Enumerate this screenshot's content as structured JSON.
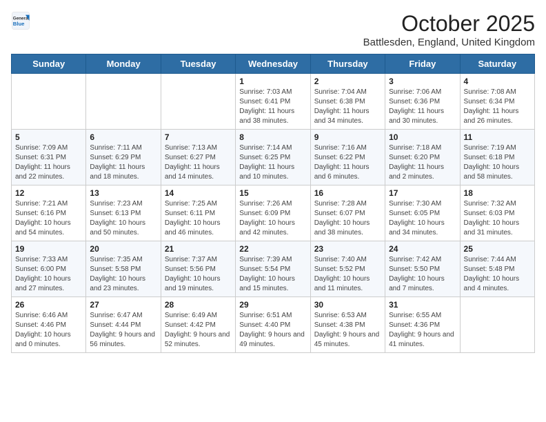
{
  "header": {
    "logo": {
      "general": "General",
      "blue": "Blue"
    },
    "title": "October 2025",
    "location": "Battlesden, England, United Kingdom"
  },
  "weekdays": [
    "Sunday",
    "Monday",
    "Tuesday",
    "Wednesday",
    "Thursday",
    "Friday",
    "Saturday"
  ],
  "weeks": [
    [
      {
        "day": "",
        "info": ""
      },
      {
        "day": "",
        "info": ""
      },
      {
        "day": "",
        "info": ""
      },
      {
        "day": "1",
        "info": "Sunrise: 7:03 AM\nSunset: 6:41 PM\nDaylight: 11 hours and 38 minutes."
      },
      {
        "day": "2",
        "info": "Sunrise: 7:04 AM\nSunset: 6:38 PM\nDaylight: 11 hours and 34 minutes."
      },
      {
        "day": "3",
        "info": "Sunrise: 7:06 AM\nSunset: 6:36 PM\nDaylight: 11 hours and 30 minutes."
      },
      {
        "day": "4",
        "info": "Sunrise: 7:08 AM\nSunset: 6:34 PM\nDaylight: 11 hours and 26 minutes."
      }
    ],
    [
      {
        "day": "5",
        "info": "Sunrise: 7:09 AM\nSunset: 6:31 PM\nDaylight: 11 hours and 22 minutes."
      },
      {
        "day": "6",
        "info": "Sunrise: 7:11 AM\nSunset: 6:29 PM\nDaylight: 11 hours and 18 minutes."
      },
      {
        "day": "7",
        "info": "Sunrise: 7:13 AM\nSunset: 6:27 PM\nDaylight: 11 hours and 14 minutes."
      },
      {
        "day": "8",
        "info": "Sunrise: 7:14 AM\nSunset: 6:25 PM\nDaylight: 11 hours and 10 minutes."
      },
      {
        "day": "9",
        "info": "Sunrise: 7:16 AM\nSunset: 6:22 PM\nDaylight: 11 hours and 6 minutes."
      },
      {
        "day": "10",
        "info": "Sunrise: 7:18 AM\nSunset: 6:20 PM\nDaylight: 11 hours and 2 minutes."
      },
      {
        "day": "11",
        "info": "Sunrise: 7:19 AM\nSunset: 6:18 PM\nDaylight: 10 hours and 58 minutes."
      }
    ],
    [
      {
        "day": "12",
        "info": "Sunrise: 7:21 AM\nSunset: 6:16 PM\nDaylight: 10 hours and 54 minutes."
      },
      {
        "day": "13",
        "info": "Sunrise: 7:23 AM\nSunset: 6:13 PM\nDaylight: 10 hours and 50 minutes."
      },
      {
        "day": "14",
        "info": "Sunrise: 7:25 AM\nSunset: 6:11 PM\nDaylight: 10 hours and 46 minutes."
      },
      {
        "day": "15",
        "info": "Sunrise: 7:26 AM\nSunset: 6:09 PM\nDaylight: 10 hours and 42 minutes."
      },
      {
        "day": "16",
        "info": "Sunrise: 7:28 AM\nSunset: 6:07 PM\nDaylight: 10 hours and 38 minutes."
      },
      {
        "day": "17",
        "info": "Sunrise: 7:30 AM\nSunset: 6:05 PM\nDaylight: 10 hours and 34 minutes."
      },
      {
        "day": "18",
        "info": "Sunrise: 7:32 AM\nSunset: 6:03 PM\nDaylight: 10 hours and 31 minutes."
      }
    ],
    [
      {
        "day": "19",
        "info": "Sunrise: 7:33 AM\nSunset: 6:00 PM\nDaylight: 10 hours and 27 minutes."
      },
      {
        "day": "20",
        "info": "Sunrise: 7:35 AM\nSunset: 5:58 PM\nDaylight: 10 hours and 23 minutes."
      },
      {
        "day": "21",
        "info": "Sunrise: 7:37 AM\nSunset: 5:56 PM\nDaylight: 10 hours and 19 minutes."
      },
      {
        "day": "22",
        "info": "Sunrise: 7:39 AM\nSunset: 5:54 PM\nDaylight: 10 hours and 15 minutes."
      },
      {
        "day": "23",
        "info": "Sunrise: 7:40 AM\nSunset: 5:52 PM\nDaylight: 10 hours and 11 minutes."
      },
      {
        "day": "24",
        "info": "Sunrise: 7:42 AM\nSunset: 5:50 PM\nDaylight: 10 hours and 7 minutes."
      },
      {
        "day": "25",
        "info": "Sunrise: 7:44 AM\nSunset: 5:48 PM\nDaylight: 10 hours and 4 minutes."
      }
    ],
    [
      {
        "day": "26",
        "info": "Sunrise: 6:46 AM\nSunset: 4:46 PM\nDaylight: 10 hours and 0 minutes."
      },
      {
        "day": "27",
        "info": "Sunrise: 6:47 AM\nSunset: 4:44 PM\nDaylight: 9 hours and 56 minutes."
      },
      {
        "day": "28",
        "info": "Sunrise: 6:49 AM\nSunset: 4:42 PM\nDaylight: 9 hours and 52 minutes."
      },
      {
        "day": "29",
        "info": "Sunrise: 6:51 AM\nSunset: 4:40 PM\nDaylight: 9 hours and 49 minutes."
      },
      {
        "day": "30",
        "info": "Sunrise: 6:53 AM\nSunset: 4:38 PM\nDaylight: 9 hours and 45 minutes."
      },
      {
        "day": "31",
        "info": "Sunrise: 6:55 AM\nSunset: 4:36 PM\nDaylight: 9 hours and 41 minutes."
      },
      {
        "day": "",
        "info": ""
      }
    ]
  ]
}
